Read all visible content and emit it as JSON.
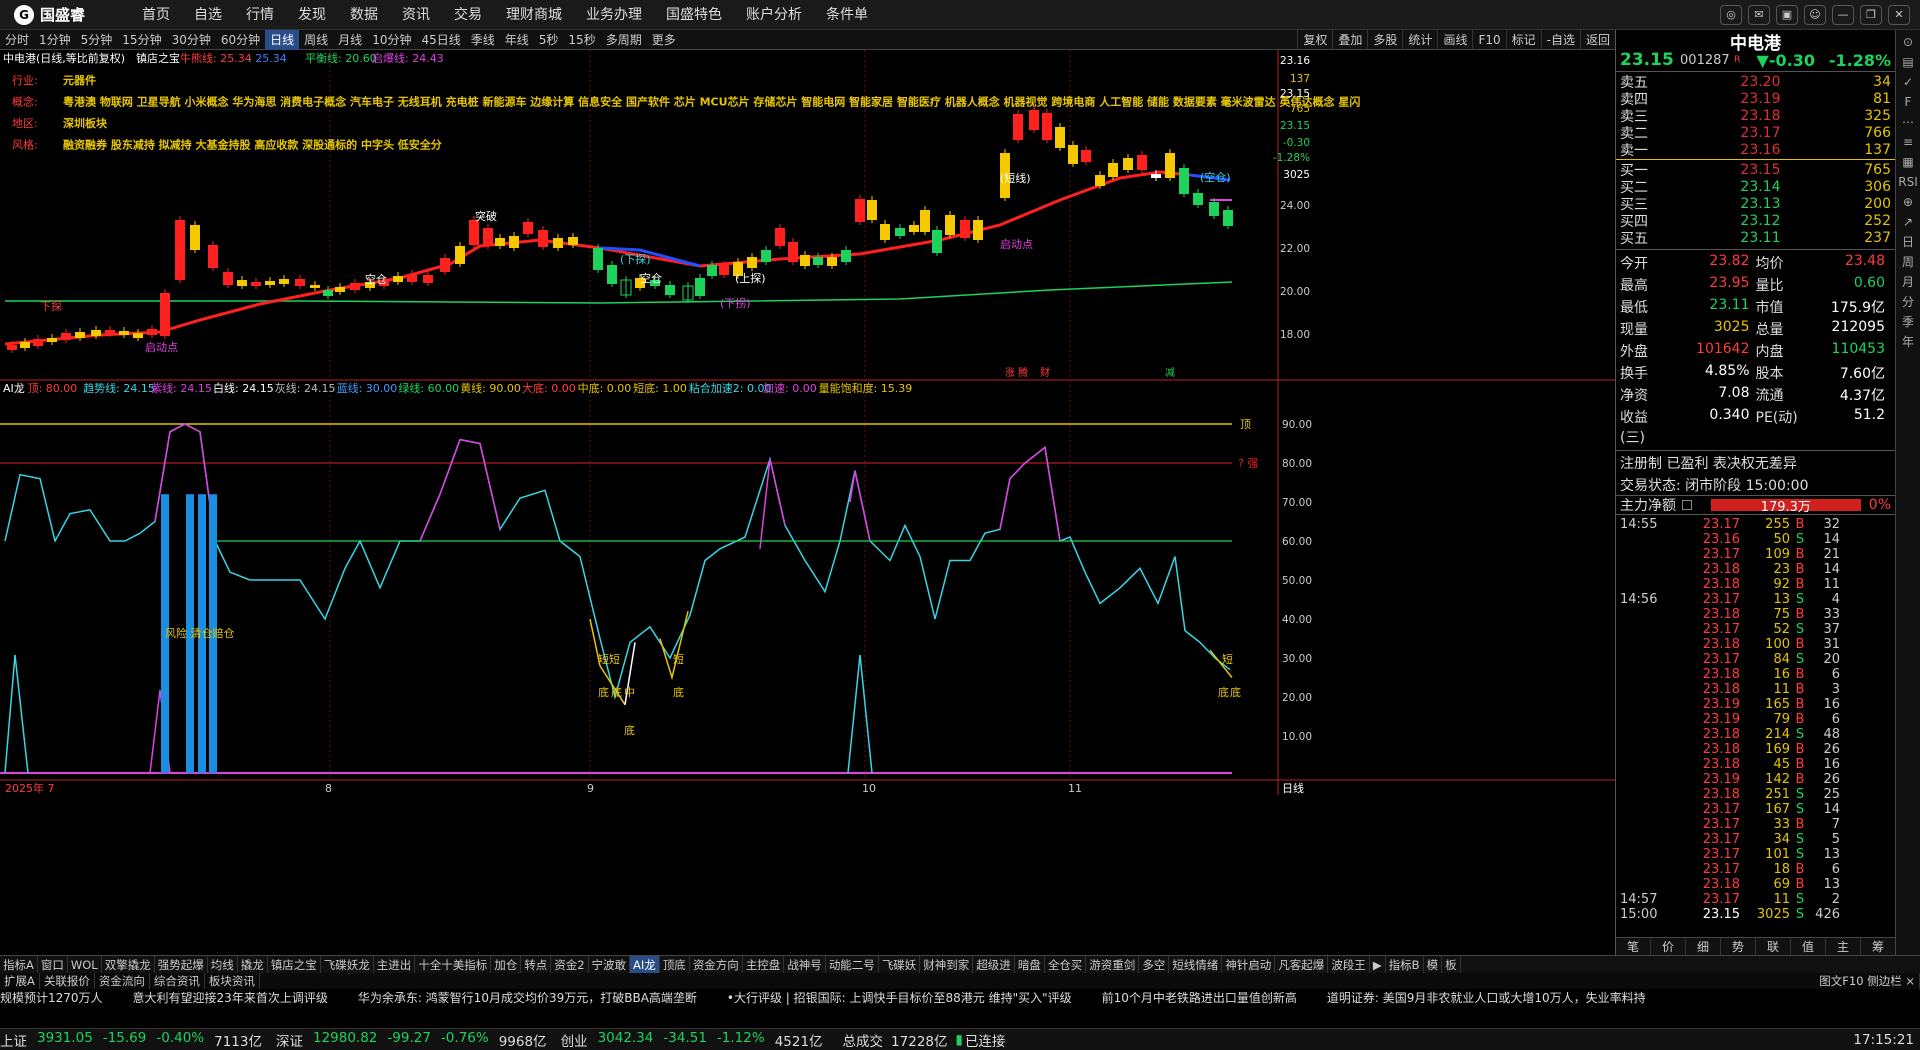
{
  "app": {
    "logo_text": "国盛睿",
    "logo_icon": "logo-icon"
  },
  "main_nav": [
    "首页",
    "自选",
    "行情",
    "发现",
    "数据",
    "资讯",
    "交易",
    "理财商城",
    "业务办理",
    "国盛特色",
    "账户分析",
    "条件单"
  ],
  "periods": [
    "分时",
    "1分钟",
    "5分钟",
    "15分钟",
    "30分钟",
    "60分钟",
    "日线",
    "周线",
    "月线",
    "10分钟",
    "45日线",
    "季线",
    "年线",
    "5秒",
    "15秒",
    "多周期",
    "更多"
  ],
  "active_period": "日线",
  "period_tools": [
    "复权",
    "叠加",
    "多股",
    "统计",
    "画线",
    "F10",
    "标记",
    "-自选",
    "返回"
  ],
  "chart_header": {
    "stock": "中电港(日线,等比前复权)",
    "indicator": "镇店之宝",
    "bull": "牛熊线: 25.34",
    "bull_val": ": 25.34",
    "balance": "平衡线: 20.60",
    "start": "启爆线: 24.43"
  },
  "info_rows": [
    {
      "key": "行业:",
      "val": "元器件"
    },
    {
      "key": "概念:",
      "val": "粤港澳 物联网 卫星导航 小米概念 华为海思 消费电子概念 汽车电子 无线耳机 充电桩 新能源车 边缘计算 信息安全 国产软件 芯片 MCU芯片 存储芯片 智能电网 智能家居 智能医疗 机器人概念 机器视觉 跨境电商 人工智能 储能 数据要素 毫米波雷达 英伟达概念 星闪"
    },
    {
      "key": "地区:",
      "val": "深圳板块"
    },
    {
      "key": "风格:",
      "val": "融资融券 股东减持 拟减持 大基金持股 高应收款 深股通标的 中字头 低安全分"
    }
  ],
  "price_axis": [
    "23.16",
    "137",
    "23.15",
    "765",
    "23.15",
    "-0.30",
    "-1.28%",
    "3025",
    "24.00",
    "22.00",
    "20.00",
    "18.00"
  ],
  "lower_header": [
    {
      "t": "AI龙",
      "c": "#fff"
    },
    {
      "t": "顶: 80.00",
      "c": "#ff3b3b"
    },
    {
      "t": "趋势线: 24.15",
      "c": "#38d6e6"
    },
    {
      "t": "紫线: 24.15",
      "c": "#e040e0"
    },
    {
      "t": "白线: 24.15",
      "c": "#fff"
    },
    {
      "t": "灰线: 24.15",
      "c": "#bbb"
    },
    {
      "t": "蓝线: 30.00",
      "c": "#38a0ff"
    },
    {
      "t": "绿线: 60.00",
      "c": "#1ed35b"
    },
    {
      "t": "黄线: 90.00",
      "c": "#e6c500"
    },
    {
      "t": "大底: 0.00",
      "c": "#ff3b3b"
    },
    {
      "t": "中底: 0.00",
      "c": "#e6c500"
    },
    {
      "t": "短底: 1.00",
      "c": "#e6c500"
    },
    {
      "t": "粘合加速2: 0.00",
      "c": "#38d6e6"
    },
    {
      "t": "加速: 0.00",
      "c": "#e040e0"
    },
    {
      "t": "量能饱和度: 15.39",
      "c": "#e6c500"
    }
  ],
  "lower_axis": [
    "90.00",
    "80.00",
    "70.00",
    "60.00",
    "50.00",
    "40.00",
    "30.00",
    "20.00",
    "10.00"
  ],
  "lower_labels": {
    "top": "顶",
    "strong": "? 强",
    "risk": "风险 清仓赔仓",
    "bottom": "底",
    "short": "短",
    "mid": "中"
  },
  "date_axis": [
    "2025年 7",
    "8",
    "9",
    "10",
    "11"
  ],
  "date_axis_right": "日线",
  "event_marks": [
    "涨 腾",
    "财",
    "减"
  ],
  "chart_annotations": [
    "下探",
    "启动点",
    "空仓",
    "突破",
    "(下探)",
    "(上探)",
    "(下拐)",
    "(空仓)",
    "启动点",
    "(短线)",
    "空仓"
  ],
  "quote": {
    "name": "中电港",
    "code": "001287",
    "badge": "R",
    "price": "23.15",
    "change": "▼-0.30",
    "pct": "-1.28%",
    "asks": [
      {
        "lbl": "卖五",
        "price": "23.20",
        "vol": "34"
      },
      {
        "lbl": "卖四",
        "price": "23.19",
        "vol": "81"
      },
      {
        "lbl": "卖三",
        "price": "23.18",
        "vol": "325"
      },
      {
        "lbl": "卖二",
        "price": "23.17",
        "vol": "766"
      },
      {
        "lbl": "卖一",
        "price": "23.16",
        "vol": "137"
      }
    ],
    "bids": [
      {
        "lbl": "买一",
        "price": "23.15",
        "vol": "765"
      },
      {
        "lbl": "买二",
        "price": "23.14",
        "vol": "306"
      },
      {
        "lbl": "买三",
        "price": "23.13",
        "vol": "200"
      },
      {
        "lbl": "买四",
        "price": "23.12",
        "vol": "252"
      },
      {
        "lbl": "买五",
        "price": "23.11",
        "vol": "237"
      }
    ],
    "stats": [
      [
        "今开",
        "23.82",
        "red",
        "均价",
        "23.48",
        "red"
      ],
      [
        "最高",
        "23.95",
        "red",
        "量比",
        "0.60",
        "green"
      ],
      [
        "最低",
        "23.11",
        "green",
        "市值",
        "175.9亿",
        "white"
      ],
      [
        "现量",
        "3025",
        "yellow",
        "总量",
        "212095",
        "white"
      ],
      [
        "外盘",
        "101642",
        "red",
        "内盘",
        "110453",
        "green"
      ],
      [
        "换手",
        "4.85%",
        "white",
        "股本",
        "7.60亿",
        "white"
      ],
      [
        "净资",
        "7.08",
        "white",
        "流通",
        "4.37亿",
        "white"
      ],
      [
        "收益(三)",
        "0.340",
        "white",
        "PE(动)",
        "51.2",
        "white"
      ]
    ],
    "reg": "注册制 已盈利 表决权无差异",
    "trade_state": "交易状态: 闭市阶段 15:00:00",
    "main_flow_label": "主力净额",
    "main_flow_val": "179.3万",
    "main_flow_pct": "0%"
  },
  "ticks": [
    {
      "t": "14:55",
      "p": "23.17",
      "v": "255",
      "bs": "B",
      "n": "32"
    },
    {
      "t": "",
      "p": "23.16",
      "v": "50",
      "bs": "S",
      "n": "14"
    },
    {
      "t": "",
      "p": "23.17",
      "v": "109",
      "bs": "B",
      "n": "21"
    },
    {
      "t": "",
      "p": "23.18",
      "v": "23",
      "bs": "B",
      "n": "14"
    },
    {
      "t": "",
      "p": "23.18",
      "v": "92",
      "bs": "B",
      "n": "11"
    },
    {
      "t": "14:56",
      "p": "23.17",
      "v": "13",
      "bs": "S",
      "n": "4"
    },
    {
      "t": "",
      "p": "23.18",
      "v": "75",
      "bs": "B",
      "n": "33"
    },
    {
      "t": "",
      "p": "23.17",
      "v": "52",
      "bs": "S",
      "n": "37"
    },
    {
      "t": "",
      "p": "23.18",
      "v": "100",
      "bs": "B",
      "n": "31"
    },
    {
      "t": "",
      "p": "23.17",
      "v": "84",
      "bs": "S",
      "n": "20"
    },
    {
      "t": "",
      "p": "23.18",
      "v": "16",
      "bs": "B",
      "n": "6"
    },
    {
      "t": "",
      "p": "23.18",
      "v": "11",
      "bs": "B",
      "n": "3"
    },
    {
      "t": "",
      "p": "23.19",
      "v": "165",
      "bs": "B",
      "n": "16"
    },
    {
      "t": "",
      "p": "23.19",
      "v": "79",
      "bs": "B",
      "n": "6"
    },
    {
      "t": "",
      "p": "23.18",
      "v": "214",
      "bs": "S",
      "n": "48"
    },
    {
      "t": "",
      "p": "23.18",
      "v": "169",
      "bs": "B",
      "n": "26"
    },
    {
      "t": "",
      "p": "23.18",
      "v": "45",
      "bs": "B",
      "n": "16"
    },
    {
      "t": "",
      "p": "23.19",
      "v": "142",
      "bs": "B",
      "n": "26"
    },
    {
      "t": "",
      "p": "23.18",
      "v": "251",
      "bs": "S",
      "n": "25"
    },
    {
      "t": "",
      "p": "23.17",
      "v": "167",
      "bs": "S",
      "n": "14"
    },
    {
      "t": "",
      "p": "23.17",
      "v": "33",
      "bs": "B",
      "n": "7"
    },
    {
      "t": "",
      "p": "23.17",
      "v": "34",
      "bs": "S",
      "n": "5"
    },
    {
      "t": "",
      "p": "23.17",
      "v": "101",
      "bs": "S",
      "n": "13"
    },
    {
      "t": "",
      "p": "23.17",
      "v": "18",
      "bs": "B",
      "n": "6"
    },
    {
      "t": "",
      "p": "23.18",
      "v": "69",
      "bs": "B",
      "n": "13"
    },
    {
      "t": "14:57",
      "p": "23.17",
      "v": "11",
      "bs": "S",
      "n": "2"
    },
    {
      "t": "15:00",
      "p": "23.15",
      "v": "3025",
      "bs": "S",
      "n": "426"
    }
  ],
  "rp_tabs": [
    "笔",
    "价",
    "细",
    "势",
    "联",
    "值",
    "主",
    "筹"
  ],
  "side_tools": [
    "⊙",
    "▤",
    "✓",
    "F",
    "⋯",
    "≡",
    "▦",
    "RSI",
    "⊕",
    "↗",
    "日",
    "周",
    "月",
    "分",
    "季",
    "年"
  ],
  "indicator_tabs": [
    "指标A",
    "窗口",
    "WOL",
    "双擎撬龙",
    "强势起爆",
    "均线",
    "撬龙",
    "镇店之宝",
    "飞碟妖龙",
    "主进出",
    "十全十美指标",
    "加仓",
    "转点",
    "资金2",
    "宁波敢",
    "AI龙",
    "顶底",
    "资金方向",
    "主控盘",
    "战神号",
    "动能二号",
    "飞碟妖",
    "财神到家",
    "超级进",
    "暗盘",
    "全仓买",
    "游资重剑",
    "多空",
    "短线情绪",
    "神针启动",
    "凡客起爆",
    "波段王",
    "▶",
    "指标B",
    "模",
    "板"
  ],
  "active_indicator": "AI龙",
  "sub_tabs": [
    "扩展A",
    "关联报价",
    "资金流向",
    "综合资讯",
    "板块资讯"
  ],
  "sub_tabs_right": "图文F10 侧边栏 ×",
  "ticker": [
    "规模预计1270万人",
    "意大利有望迎接23年来首次上调评级",
    "华为余承东: 鸿蒙智行10月成交均价39万元，打破BBA高端垄断",
    "•大行评级 | 招银国际: 上调快手目标价至88港元 维持\"买入\"评级",
    "前10个月中老铁路进出口量值创新高",
    "道明证券: 美国9月非农就业人口或大增10万人，失业率料持"
  ],
  "indices": [
    {
      "name": "上证",
      "val": "3931.05",
      "chg": "-15.69",
      "pct": "-0.40%",
      "amt": "7113亿"
    },
    {
      "name": "深证",
      "val": "12980.82",
      "chg": "-99.27",
      "pct": "-0.76%",
      "amt": "9968亿"
    },
    {
      "name": "创业",
      "val": "3042.34",
      "chg": "-34.51",
      "pct": "-1.12%",
      "amt": "4521亿"
    }
  ],
  "total_label": "总成交",
  "total_val": "17228亿",
  "connection": "已连接",
  "clock": "17:15:21",
  "colors": {
    "up": "#ff3b3b",
    "down": "#1ed35b",
    "yellow": "#e6c500",
    "cyan": "#38d6e6",
    "magenta": "#e040e0"
  }
}
